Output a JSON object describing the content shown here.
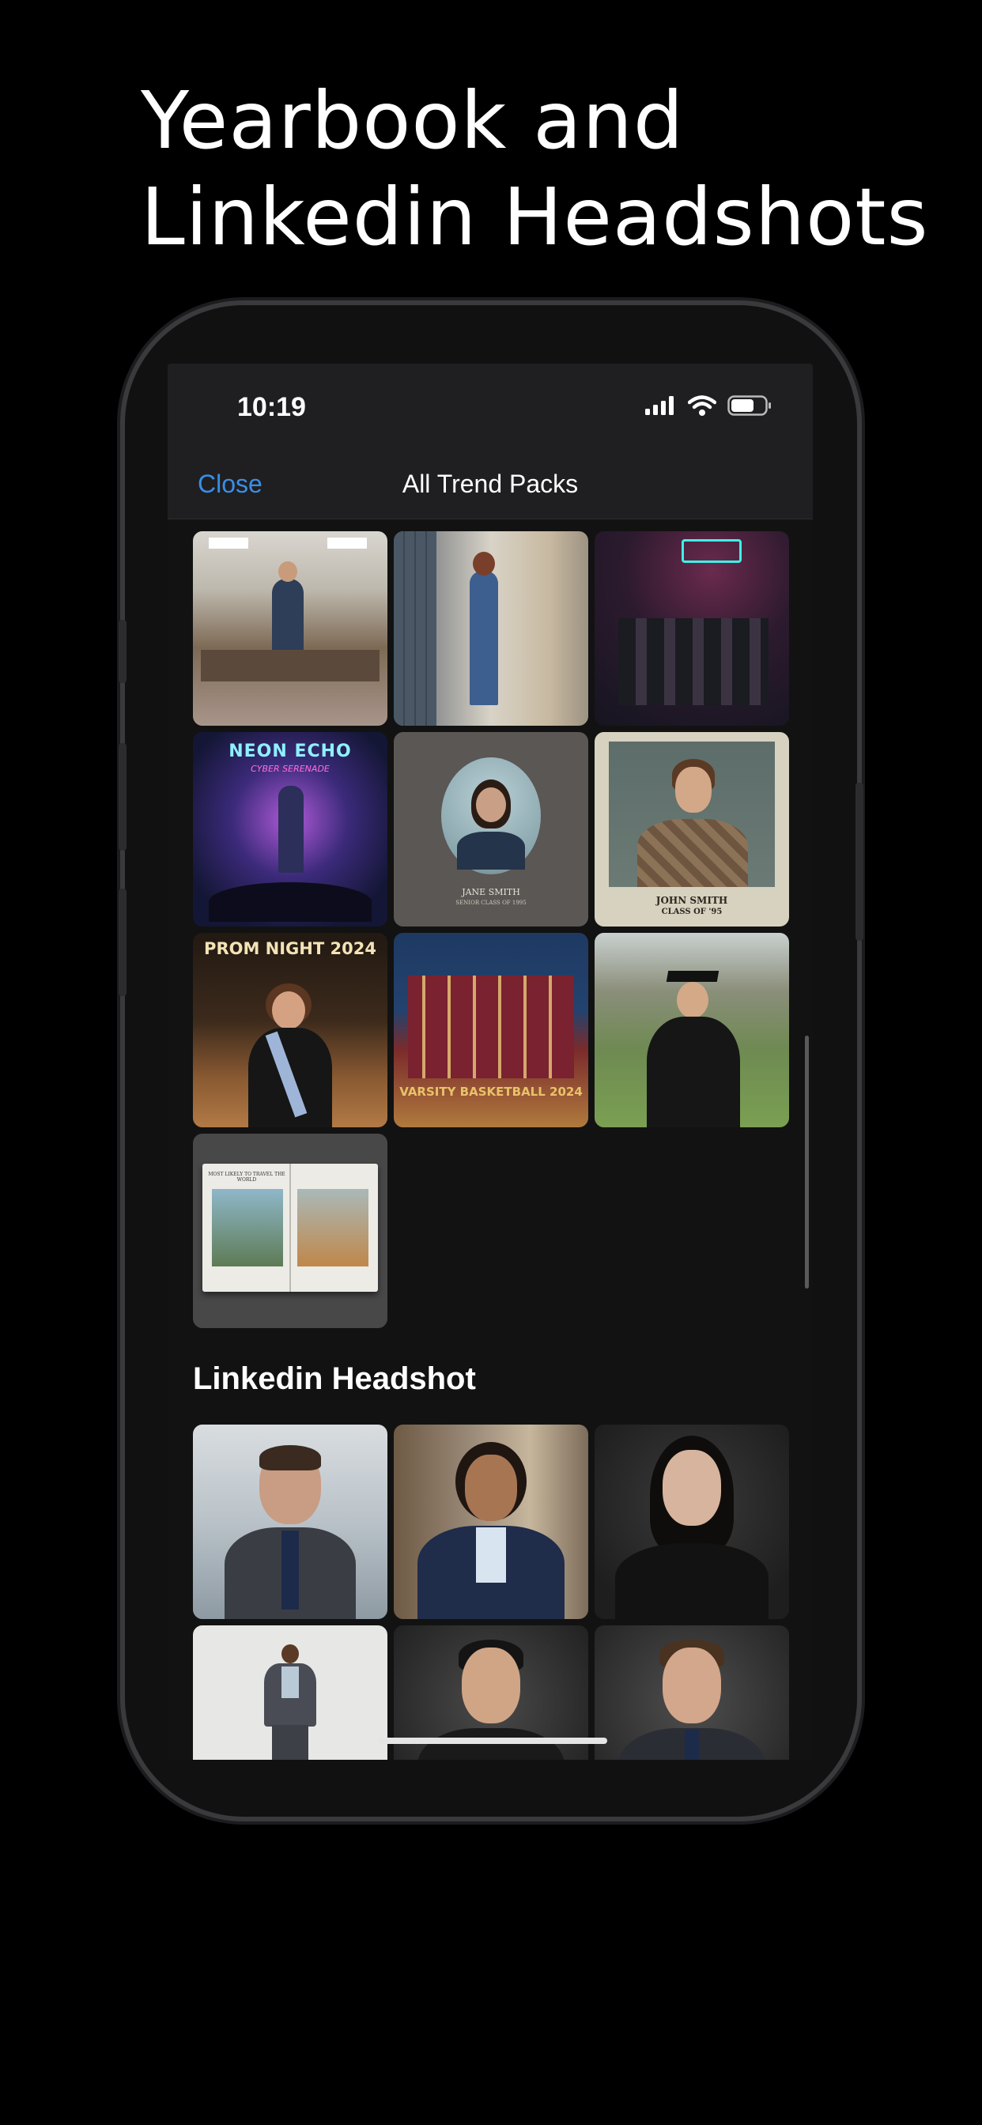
{
  "headline": {
    "line1": "Yearbook and",
    "line2": "Linkedin Headshots"
  },
  "status_bar": {
    "time": "10:19",
    "icons": [
      "signal-icon",
      "wifi-icon",
      "battery-icon"
    ]
  },
  "nav": {
    "close_label": "Close",
    "title": "All Trend Packs"
  },
  "yearbook_pack": {
    "tiles": [
      {
        "name": "classroom-party",
        "caption": ""
      },
      {
        "name": "school-hallway",
        "caption": ""
      },
      {
        "name": "neon-arcade-party",
        "caption": ""
      },
      {
        "name": "neon-echo-poster",
        "caption": "NEON ECHO",
        "subcaption": "CYBER SERENADE"
      },
      {
        "name": "vintage-portrait-woman",
        "caption": "JANE SMITH",
        "subcaption": "SENIOR CLASS OF 1995"
      },
      {
        "name": "vintage-portrait-man",
        "caption": "JOHN SMITH",
        "subcaption": "CLASS OF '95"
      },
      {
        "name": "prom-night",
        "caption": "PROM NIGHT 2024"
      },
      {
        "name": "varsity-basketball",
        "caption": "VARSITY BASKETBALL 2024"
      },
      {
        "name": "graduation",
        "caption": ""
      },
      {
        "name": "yearbook-book",
        "caption": "MOST LIKELY TO TRAVEL THE WORLD"
      }
    ]
  },
  "linkedin_pack": {
    "title": "Linkedin Headshot",
    "tiles": [
      {
        "name": "office-man-headshot"
      },
      {
        "name": "street-woman-headshot"
      },
      {
        "name": "studio-woman-headshot"
      },
      {
        "name": "standing-woman-fullbody"
      },
      {
        "name": "studio-man-headshot"
      },
      {
        "name": "suit-man-headshot"
      }
    ]
  },
  "colors": {
    "accent": "#3a8ee6",
    "background": "#000000",
    "screen_bg": "#121212",
    "bar_bg": "#1f1f21"
  }
}
